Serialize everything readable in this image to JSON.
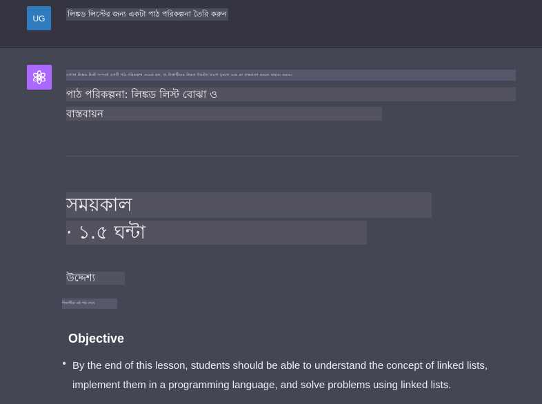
{
  "user_message": {
    "avatar_initials": "UG",
    "text": "লিঙ্কড লিস্টের জন্য একটা পাঠ পরিকল্পনা তৈরি করুন"
  },
  "assistant_message": {
    "avatar_icon": "openai-logo-icon",
    "intro_line": "এখানে লিঙ্কড লিস্ট সম্পর্কে একটি পাঠ পরিকল্পনা দেওয়া হল, যা শিক্ষার্থীদের লিঙ্কড লিস্টের ধারণা বুঝতে এবং তা বাস্তবায়ন করতে সাহায্য করবে।",
    "title_line1": "পাঠ পরিকল্পনা: লিঙ্কড লিস্ট বোঝা ও",
    "title_line2": "বাস্তবায়ন",
    "duration_heading": "সময়কাল",
    "duration_value": "· ১.৫ ঘন্টা",
    "objective_heading_bn": "উদ্দেশ্য",
    "small_text": "শিক্ষার্থীরা এই পাঠ শেষে",
    "objective_heading": "Objective",
    "objective_bullet": "By the end of this lesson, students should be able to understand the concept of linked lists, implement them in a programming language, and solve problems using linked lists."
  },
  "colors": {
    "background_user": "#343541",
    "background_assistant": "#444654",
    "avatar_user": "#2f7bbd",
    "avatar_assistant": "#ab68ff"
  }
}
